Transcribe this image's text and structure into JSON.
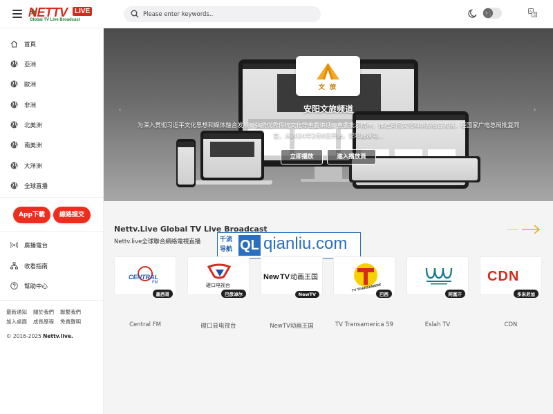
{
  "header": {
    "logo_main": "NETTV",
    "logo_live": "LIVE",
    "logo_sub": "Global TV Live Broadcast",
    "search_placeholder": "Please enter keywords.."
  },
  "sidebar": {
    "items": [
      {
        "label": "首頁",
        "icon": "home-icon"
      },
      {
        "label": "亞洲",
        "icon": "globe-icon"
      },
      {
        "label": "歐洲",
        "icon": "globe-icon"
      },
      {
        "label": "非洲",
        "icon": "globe-icon"
      },
      {
        "label": "北美洲",
        "icon": "globe-icon"
      },
      {
        "label": "南美洲",
        "icon": "globe-icon"
      },
      {
        "label": "大洋洲",
        "icon": "globe-icon"
      },
      {
        "label": "全球直播",
        "icon": "globe-icon"
      }
    ],
    "app_button": "App下載",
    "submit_button": "線路提交",
    "extra_items": [
      {
        "label": "廣播電台",
        "icon": "radio-icon"
      },
      {
        "label": "收看指南",
        "icon": "sitemap-icon"
      },
      {
        "label": "幫助中心",
        "icon": "help-icon"
      }
    ],
    "links_row1": [
      "最新通知",
      "關於我們",
      "聯繫我們"
    ],
    "links_row2": [
      "加入桌面",
      "成長歷程",
      "免責聲明"
    ],
    "copyright_prefix": "© 2016-2025 ",
    "copyright_site": "Nettv.live."
  },
  "banner": {
    "brand_text": "文 旅",
    "title": "安阳文旅频道",
    "description": "为深入贯彻习近平文化思想和媒体融合发展、弘扬优秀传统文化等重要讲话、重要批示精神，推进安阳文化和旅游融合发展，经国家广电总局批复同意，从2024年2月8日开始，安阳融媒电...",
    "play_button": "立即播放",
    "enter_button": "進入播放頁"
  },
  "section": {
    "title": "Nettv.Live Global TV Live Broadcast",
    "subtitle": "Nettv.live全球聯合網絡電視直播"
  },
  "watermark": {
    "cn_top": "千流",
    "cn_bottom": "导航",
    "ql": "QL",
    "url": "qianliu.com"
  },
  "channels": [
    {
      "name": "Central FM",
      "tag": "墨西哥",
      "logo": "CENTRAL FM"
    },
    {
      "name": "磴口县电视台",
      "tag": "巴彦淖尔",
      "logo": "磴口电视台"
    },
    {
      "name": "NewTV动画王国",
      "tag": "NewTV",
      "logo": "NewTV动画王国"
    },
    {
      "name": "TV Transamerica 59",
      "tag": "巴西",
      "logo": "TV TRANSAMERICA"
    },
    {
      "name": "Eslah TV",
      "tag": "阿富汗",
      "logo": "Eslah"
    },
    {
      "name": "CDN",
      "tag": "多米尼加",
      "logo": "CDN"
    }
  ],
  "colors": {
    "accent_red": "#ef2d1e",
    "accent_orange": "#f5a623",
    "banner_bg": "#5a5a5a"
  }
}
